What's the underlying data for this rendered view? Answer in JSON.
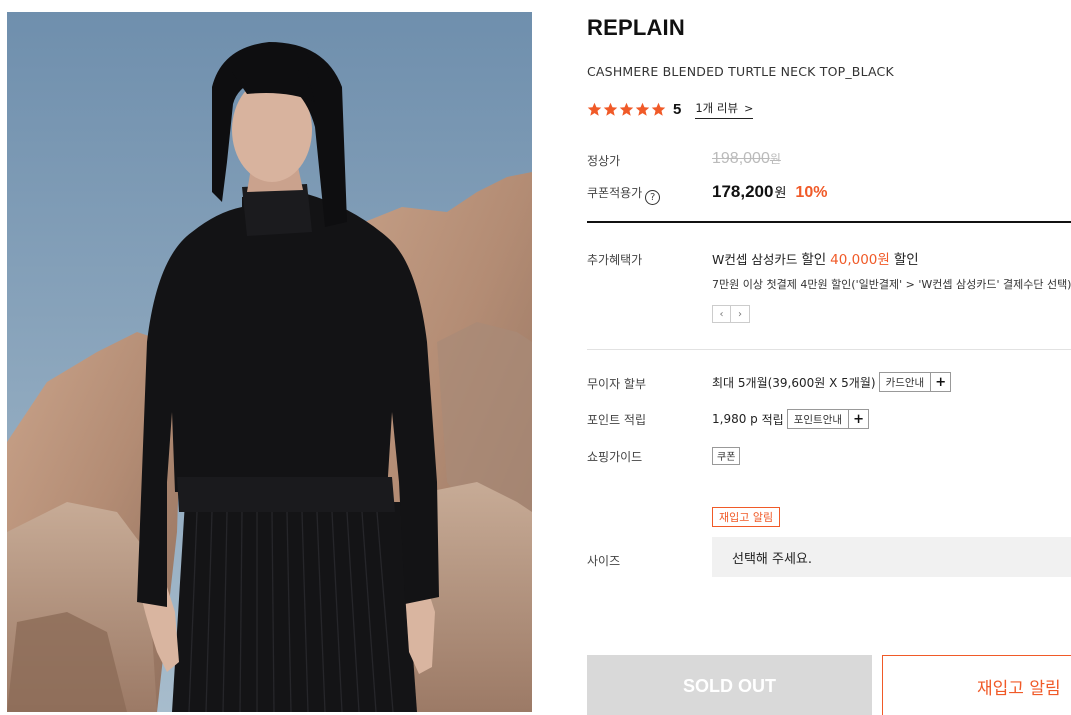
{
  "product": {
    "brand": "REPLAIN",
    "name": "CASHMERE BLENDED TURTLE NECK TOP_BLACK",
    "rating_score": "5",
    "review_link": "1개 리뷰",
    "star_color": "#f05a28"
  },
  "price": {
    "regular_label": "정상가",
    "regular_value": "198,000",
    "regular_unit": "원",
    "coupon_label": "쿠폰적용가",
    "coupon_help": "?",
    "sale_value": "178,200",
    "sale_unit": "원",
    "discount_rate": "10%",
    "accent_color": "#f05a28"
  },
  "benefits": {
    "label": "추가혜택가",
    "card_prefix": "W컨셉 삼성카드",
    "discount_word": "할인",
    "amount": "40,000원",
    "suffix": "할인",
    "detail": "7만원 이상 첫결제 4만원 할인('일반결제' > 'W컨셉 삼성카드' 결제수단 선택)",
    "prev": "‹",
    "next": "›"
  },
  "installment": {
    "label": "무이자 할부",
    "text": "최대 5개월(39,600원 X 5개월)",
    "button": "카드안내",
    "plus": "+"
  },
  "points": {
    "label": "포인트 적립",
    "value": "1,980 p",
    "word": "적립",
    "button": "포인트안내",
    "plus": "+"
  },
  "guide": {
    "label": "쇼핑가이드",
    "tag": "쿠폰"
  },
  "restock_tag": "재입고 알림",
  "size": {
    "label": "사이즈",
    "placeholder": "선택해 주세요."
  },
  "actions": {
    "soldout": "SOLD OUT",
    "restock": "재입고 알림"
  }
}
